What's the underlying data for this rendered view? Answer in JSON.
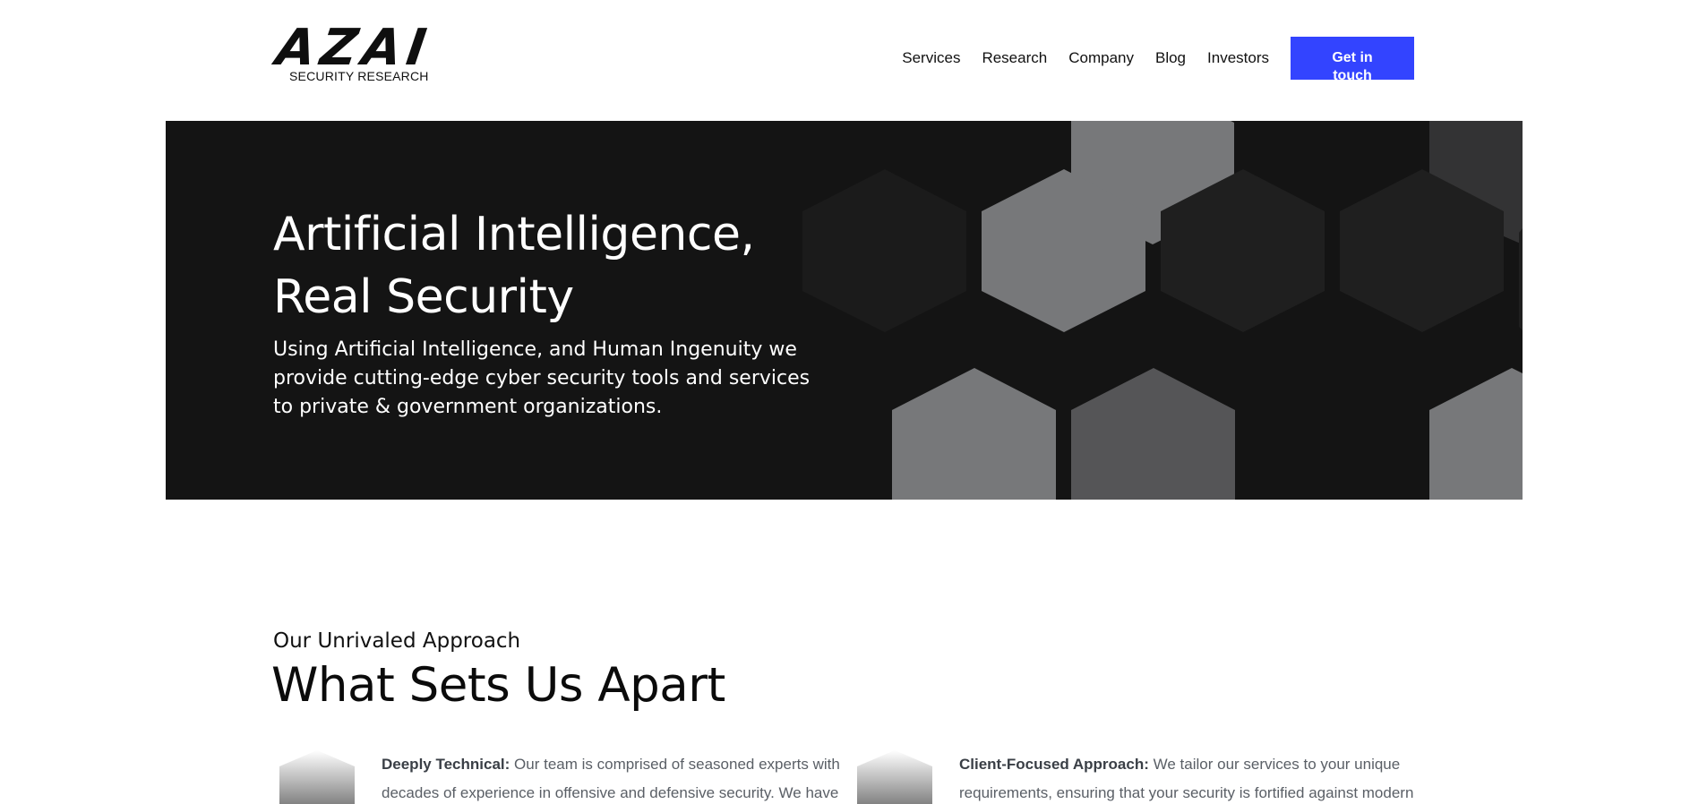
{
  "header": {
    "logo_text": "AZAI",
    "logo_subtitle": "SECURITY RESEARCH",
    "nav": [
      "Services",
      "Research",
      "Company",
      "Blog",
      "Investors"
    ],
    "cta_label": "Get in touch"
  },
  "hero": {
    "title_line1": "Artificial Intelligence,",
    "title_line2": "Real Security",
    "description": "Using Artificial Intelligence, and Human Ingenuity we provide cutting-edge cyber security tools and services to private & government organizations."
  },
  "approach": {
    "kicker": "Our Unrivaled Approach",
    "title": "What Sets Us Apart",
    "features": [
      {
        "title": "Deeply Technical:",
        "body": "Our team is comprised of seasoned experts with decades of experience in offensive and defensive security. We have"
      },
      {
        "title": "Client-Focused Approach:",
        "body": "We tailor our services to your unique requirements, ensuring that your security is fortified against modern"
      }
    ]
  },
  "colors": {
    "accent": "#3344ff",
    "hero_bg": "#141414",
    "hex_light": "#77787a",
    "hex_mid": "#555557",
    "hex_dark": "#1f1f1f",
    "hex_darker": "#333334"
  }
}
